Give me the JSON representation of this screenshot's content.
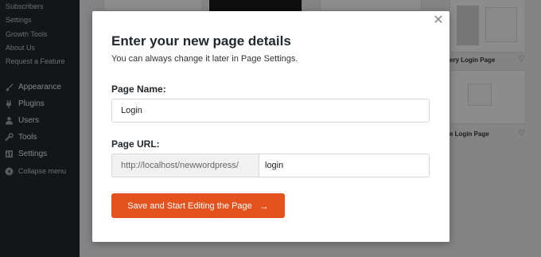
{
  "sidebar": {
    "submenu": [
      "Subscribers",
      "Settings",
      "Growth Tools",
      "About Us",
      "Request a Feature"
    ],
    "menu": [
      {
        "label": "Appearance",
        "icon": "paintbrush-icon"
      },
      {
        "label": "Plugins",
        "icon": "plugins-icon"
      },
      {
        "label": "Users",
        "icon": "users-icon"
      },
      {
        "label": "Tools",
        "icon": "wrench-icon"
      },
      {
        "label": "Settings",
        "icon": "settings-icon"
      }
    ],
    "collapse_label": "Collapse menu"
  },
  "background": {
    "cards": [
      "ery Login Page",
      "e Login Page"
    ]
  },
  "modal": {
    "title": "Enter your new page details",
    "subtitle": "You can always change it later in Page Settings.",
    "page_name_label": "Page Name:",
    "page_name_value": "Login",
    "page_url_label": "Page URL:",
    "url_prefix": "http://localhost/newwordpress/",
    "url_slug": "login",
    "save_label": "Save and Start Editing the Page",
    "save_arrow": "→",
    "close_glyph": "✕"
  },
  "colors": {
    "accent": "#e4521e",
    "sidebar_bg": "#23282d"
  }
}
